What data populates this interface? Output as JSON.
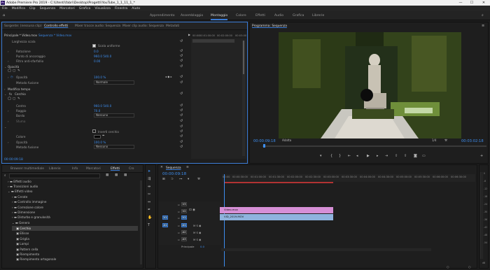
{
  "window": {
    "title": "Adobe Premiere Pro 2019 - C:\\Utenti\\fabri\\Desktop\\Progetti\\YouTube_1_1_11_1_*",
    "minimize": "—",
    "maximize": "☐",
    "close": "✕"
  },
  "menu": [
    "File",
    "Modifica",
    "Clip",
    "Sequenza",
    "Marcatori",
    "Grafica",
    "Visualizza",
    "Finestra",
    "Aiuto"
  ],
  "workspaces": [
    "Apprendimento",
    "Assemblaggio",
    "Montaggio",
    "Colore",
    "Effetti",
    "Audio",
    "Grafica",
    "Librerie"
  ],
  "active_workspace": "Montaggio",
  "effect_controls": {
    "tabs": [
      "Sorgente: (nessuna clip)",
      "Controllo effetti",
      "Mixer tracce audio: Sequenza",
      "Mixer clip audio: Sequenza",
      "Metadati"
    ],
    "breadcrumb_master": "Principale * Video.mov",
    "breadcrumb_clip": "Sequenza * Video.mov",
    "timecodes": [
      "00:00",
      "00:01:00:00",
      "00:02:00:00",
      "00:03:00"
    ],
    "rows": {
      "larghezza": "Larghezza scala",
      "scala_uniforme": "Scala uniforme",
      "rotazione": "Rotazione",
      "rotazione_val": "0.0",
      "punto_ancoraggio": "Punto di ancoraggio",
      "punto_ancoraggio_val": "960.0   540.0",
      "filtro": "Filtro anti-sfarfallio",
      "filtro_val": "0.00",
      "opacita": "Opacità",
      "opacita_row": "Opacità",
      "opacita_val": "100.0 %",
      "metodo_fusione": "Metodo fusione",
      "metodo_fusione_val": "Normale",
      "modifica_tempo": "Modifica tempo",
      "cerchio": "Cerchio",
      "centro": "Centro",
      "centro_val": "960.0   540.0",
      "raggio": "Raggio",
      "raggio_val": "70.0",
      "bordo": "Bordo",
      "bordo_val": "Nessuno",
      "sfuma": "Sfuma",
      "inverti": "Inverti cerchio",
      "colore": "Colore",
      "opacita2": "Opacità",
      "opacita2_val": "100.0 %",
      "metodo2": "Metodo fusione",
      "metodo2_val": "Nessuno"
    },
    "footer_tc": "00:00:09:18"
  },
  "program": {
    "tab": "Programma: Sequenza",
    "timecode": "00:00:09:18",
    "fit": "Adatta",
    "quality": "1/4",
    "duration": "00:03:02:18"
  },
  "effects_panel": {
    "tabs": [
      "Browser multimediale",
      "Librerie",
      "Info",
      "Marcatori",
      "Effetti",
      "Cro"
    ],
    "search_placeholder": "",
    "items": [
      "Effetti audio",
      "Transizioni audio",
      "Effetti video",
      "Cerate",
      "Controllo immagine",
      "Correzione colore",
      "Dimensione",
      "Disturbo e granulosità",
      "Genera",
      "Cerchio",
      "Ellisse",
      "Griglia",
      "Lampi",
      "Pattern cella",
      "Riempimento",
      "Riempimento ortogonale"
    ]
  },
  "timeline": {
    "tab": "Sequenza",
    "timecode": "00:00:09:18",
    "ruler": [
      "00:00",
      "00:00:30:00",
      "00:01:00:00",
      "00:01:30:00",
      "00:02:00:00",
      "00:02:30:00",
      "00:03:00:00",
      "00:03:30:00",
      "00:04:00:00",
      "00:04:30:00",
      "00:05:00:00",
      "00:05:30:00",
      "00:06:00:00",
      "00:06:30:00"
    ],
    "video_tracks": [
      "V3",
      "V2",
      "V1"
    ],
    "audio_tracks": [
      "A1",
      "A2",
      "A3"
    ],
    "source_v": "V1",
    "source_a": "A1",
    "master": "Principale",
    "master_val": "0.0",
    "clips": {
      "v2": "Video.mov",
      "v1": "VID_2019.MOV"
    }
  },
  "meter_labels": [
    "0",
    "-6",
    "-12",
    "-18",
    "-24",
    "-30",
    "-36",
    "-42",
    "-48",
    "-54",
    "dB"
  ],
  "colors": {
    "accent": "#3a7bd5",
    "timecode": "#3d8ef0",
    "clip_v2": "#d68fd6",
    "clip_v1": "#8fb3de"
  }
}
